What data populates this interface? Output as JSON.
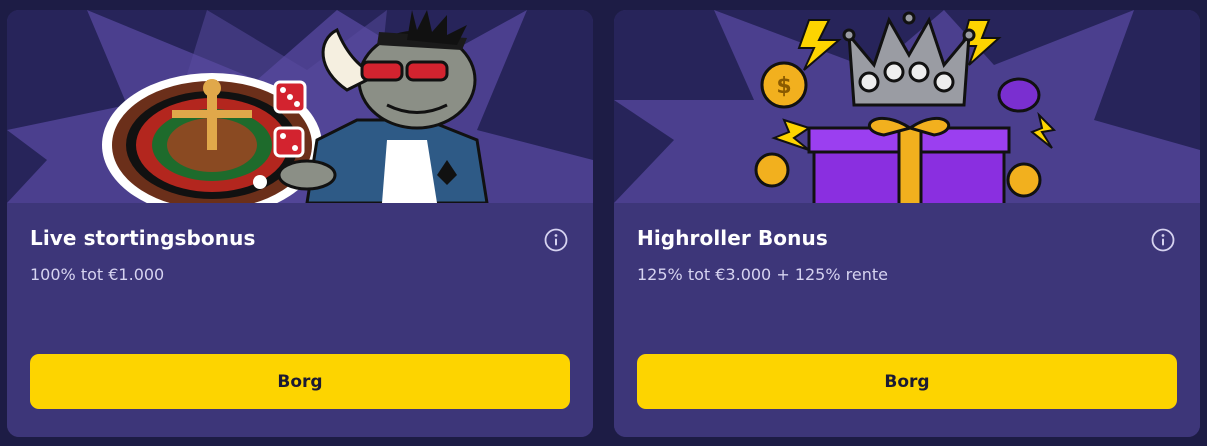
{
  "cards": [
    {
      "title": "Live stortingsbonus",
      "subtitle": "100% tot €1.000",
      "button_label": "Borg",
      "hero_illustration": "rhino-roulette-illustration",
      "info_icon": "info-icon"
    },
    {
      "title": "Highroller Bonus",
      "subtitle": "125% tot €3.000 + 125% rente",
      "button_label": "Borg",
      "hero_illustration": "crown-gift-illustration",
      "info_icon": "info-icon"
    }
  ],
  "colors": {
    "page_bg": "#1d1c45",
    "card_bg": "#3d3679",
    "hero_bg": "#27245a",
    "button_bg": "#fdd400",
    "button_text": "#1b1a33",
    "title_text": "#ffffff",
    "subtitle_text": "#d6d3f0"
  }
}
